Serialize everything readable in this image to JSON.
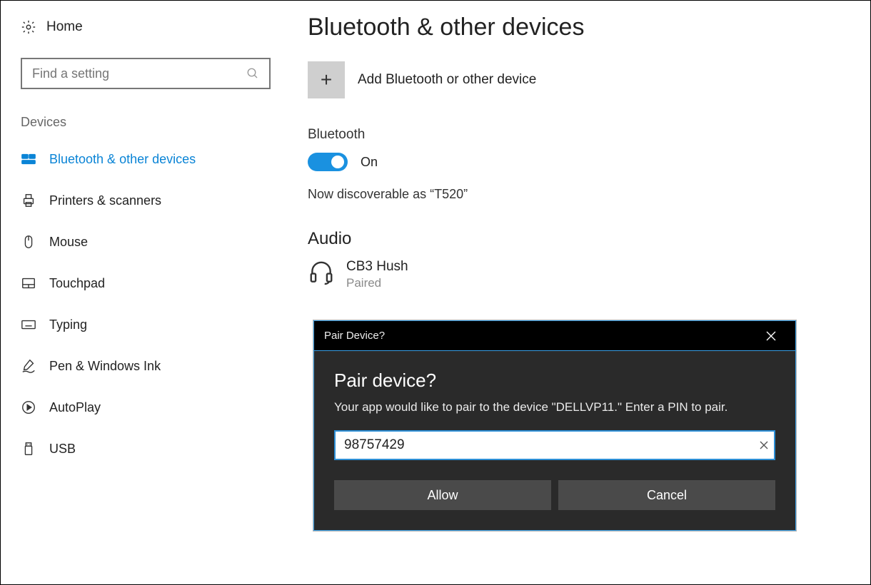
{
  "sidebar": {
    "home": "Home",
    "search_placeholder": "Find a setting",
    "group": "Devices",
    "items": [
      {
        "label": "Bluetooth & other devices",
        "icon": "bluetooth-devices-icon",
        "active": true
      },
      {
        "label": "Printers & scanners",
        "icon": "printer-icon"
      },
      {
        "label": "Mouse",
        "icon": "mouse-icon"
      },
      {
        "label": "Touchpad",
        "icon": "touchpad-icon"
      },
      {
        "label": "Typing",
        "icon": "keyboard-icon"
      },
      {
        "label": "Pen & Windows Ink",
        "icon": "pen-icon"
      },
      {
        "label": "AutoPlay",
        "icon": "autoplay-icon"
      },
      {
        "label": "USB",
        "icon": "usb-icon"
      }
    ]
  },
  "main": {
    "title": "Bluetooth & other devices",
    "add_label": "Add Bluetooth or other device",
    "bt_label": "Bluetooth",
    "bt_state": "On",
    "discoverable": "Now discoverable as “T520”",
    "audio_label": "Audio",
    "device": {
      "name": "CB3 Hush",
      "status": "Paired"
    }
  },
  "dialog": {
    "titlebar": "Pair Device?",
    "heading": "Pair device?",
    "message": "Your app would like to pair to the device \"DELLVP11.\" Enter a PIN to pair.",
    "pin_value": "98757429",
    "allow": "Allow",
    "cancel": "Cancel"
  }
}
